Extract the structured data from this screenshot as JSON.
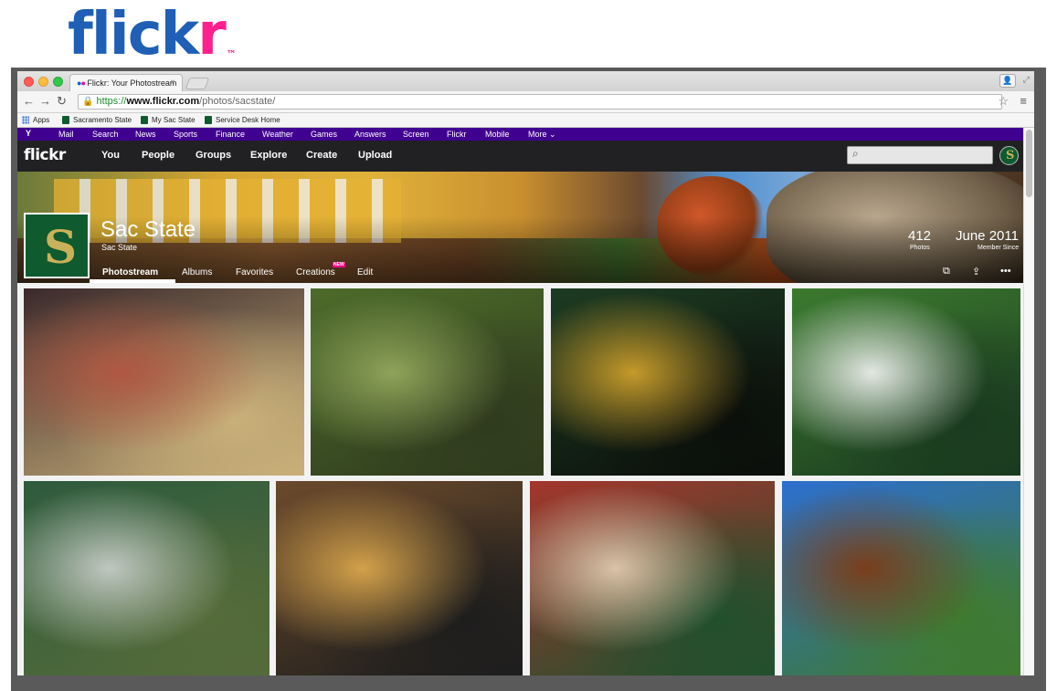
{
  "logo": {
    "text_main": "flick",
    "text_accent": "r",
    "trademark": "™"
  },
  "browser": {
    "tab_title": "Flickr: Your Photostream",
    "tab_close": "×",
    "url_https": "https://",
    "url_host": "www.flickr.com",
    "url_path": "/photos/sacstate/",
    "bookmarks": [
      "Apps",
      "Sacramento State",
      "My Sac State",
      "Service Desk Home"
    ]
  },
  "yahoo_bar": {
    "logo": "Y",
    "items": [
      "Mail",
      "Search",
      "News",
      "Sports",
      "Finance",
      "Weather",
      "Games",
      "Answers",
      "Screen",
      "Flickr",
      "Mobile",
      "More ⌄"
    ]
  },
  "flickr_nav": {
    "logo": "flickr",
    "items": [
      "You",
      "People",
      "Groups",
      "Explore",
      "Create",
      "Upload"
    ]
  },
  "profile": {
    "name": "Sac State",
    "username": "Sac State",
    "photos_count": "412",
    "photos_label": "Photos",
    "member_since": "June 2011",
    "member_since_label": "Member Since",
    "tabs": [
      "Photostream",
      "Albums",
      "Favorites",
      "Creations",
      "Edit"
    ],
    "new_badge": "NEW",
    "active_tab": "Photostream"
  },
  "colors": {
    "flickr_blue": "#1f5fb6",
    "flickr_pink": "#ff1f8e",
    "yahoo_purple": "#400090",
    "nav_dark": "#212124",
    "sac_green": "#0f5a2e"
  },
  "photos": [
    {
      "name": "photo-graduates-selfie",
      "c1": "#3b2a2c",
      "c2": "#b05842",
      "c3": "#c9b07a"
    },
    {
      "name": "photo-students-walking",
      "c1": "#4d6b2a",
      "c2": "#8fa35a",
      "c3": "#2f3b1e"
    },
    {
      "name": "photo-hornet-mascot-homecoming",
      "c1": "#1d3b22",
      "c2": "#c59a2a",
      "c3": "#0b0f0b"
    },
    {
      "name": "photo-football-player",
      "c1": "#3c7a2f",
      "c2": "#e3e8e2",
      "c3": "#1a3a1f"
    },
    {
      "name": "photo-farmers-market",
      "c1": "#2e5b3d",
      "c2": "#bfc7c0",
      "c3": "#556b3a"
    },
    {
      "name": "photo-jazz-band",
      "c1": "#6b4a2c",
      "c2": "#d3a14a",
      "c3": "#1d1d1d"
    },
    {
      "name": "photo-crowd-rally",
      "c1": "#a3362d",
      "c2": "#d9c2a7",
      "c3": "#21502d"
    },
    {
      "name": "photo-campus-sculpture",
      "c1": "#2d6fcf",
      "c2": "#7a3e1d",
      "c3": "#3f7a2f"
    }
  ]
}
